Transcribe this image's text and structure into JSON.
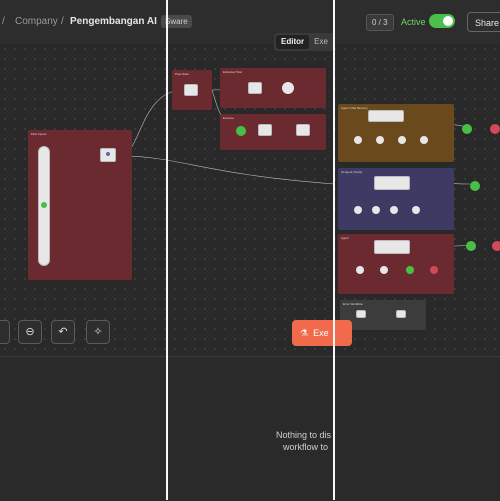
{
  "breadcrumb": {
    "parent": "Company",
    "separator": "/",
    "current": "Pengembangan AI"
  },
  "share_badge": "Sware",
  "counter": "0 / 3",
  "status": {
    "label": "Active",
    "on": true
  },
  "share_button": "Share",
  "tabs": [
    {
      "label": "Editor",
      "active": true
    },
    {
      "label": "Exe",
      "active": false
    }
  ],
  "execute_button": "Exe",
  "empty_state": {
    "line1": "Nothing to dis",
    "line2": "workflow to"
  },
  "canvas_controls": [
    {
      "icon": "zoom-out-icon",
      "glyph": "⊖"
    },
    {
      "icon": "undo-icon",
      "glyph": "↶"
    },
    {
      "icon": "clean-up-icon",
      "glyph": "✧"
    }
  ],
  "groups": {
    "flow_inputs": "Flow Inputs",
    "prepare": "Prep Data",
    "extracted": "Extracted Text",
    "execute": "Execute",
    "agent_a": "Agent Chat Memory",
    "agent_b": "AI Agent (Tools)",
    "agent_c": "Agent",
    "error": "Error Workflow"
  },
  "colors": {
    "group_red": "#6a2a30",
    "group_orange": "#6a4a1c",
    "group_purple": "#3e3a64",
    "group_gray": "#3c3c3c",
    "accent": "#f06a4b",
    "active_green": "#4bbf4a"
  }
}
